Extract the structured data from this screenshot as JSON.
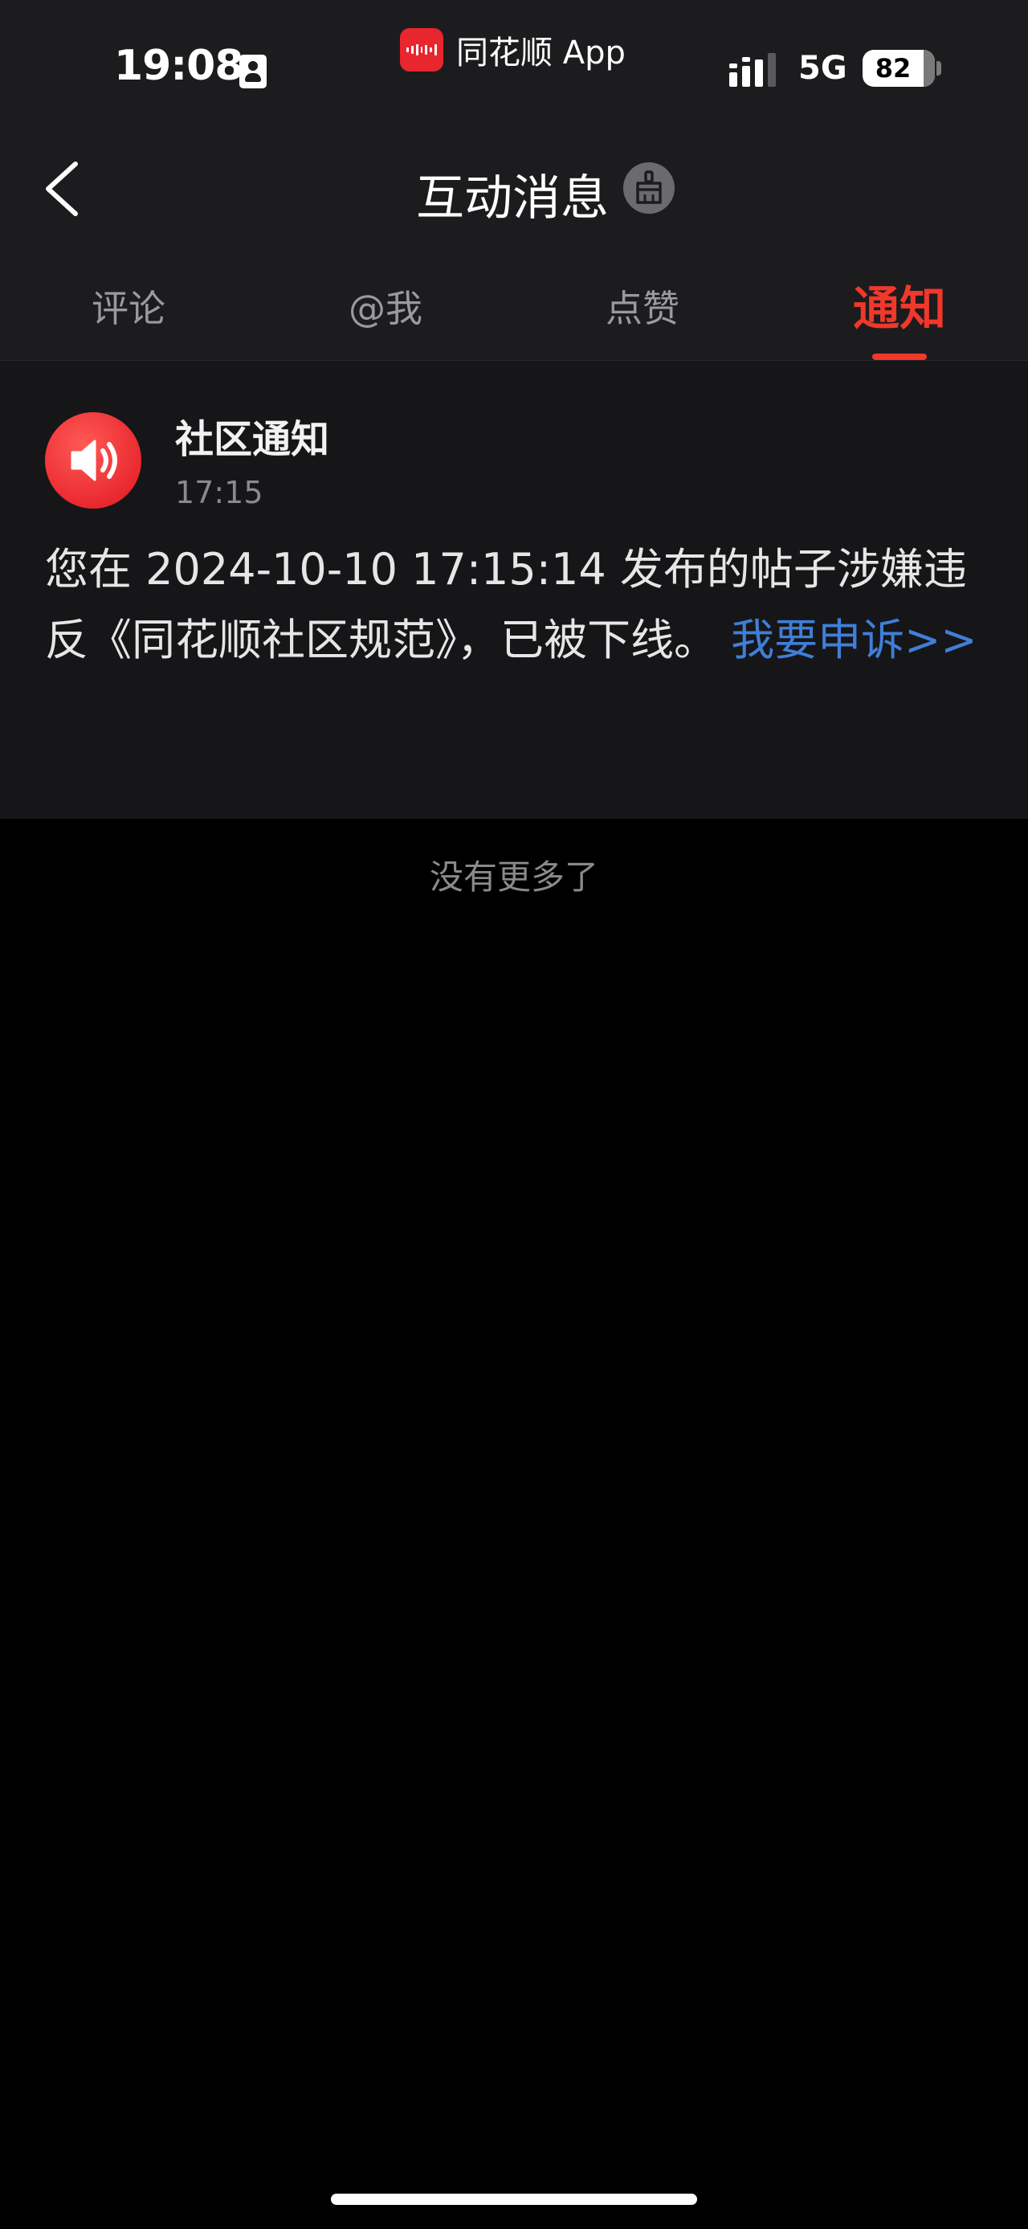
{
  "status_bar": {
    "time": "19:08",
    "app_name": "同花顺 App",
    "network": "5G",
    "battery_level": "82",
    "icons": [
      "contact-card-icon",
      "app-logo-icon",
      "signal-icon",
      "battery-icon"
    ]
  },
  "nav": {
    "title": "互动消息",
    "back_icon": "chevron-left-icon",
    "clear_icon": "broom-icon"
  },
  "tabs": [
    {
      "label": "评论",
      "active": false
    },
    {
      "label": "@我",
      "active": false
    },
    {
      "label": "点赞",
      "active": false
    },
    {
      "label": "通知",
      "active": true
    }
  ],
  "notification": {
    "icon": "speaker-icon",
    "title": "社区通知",
    "time": "17:15",
    "message": "您在 2024-10-10 17:15:14 发布的帖子涉嫌违反《同花顺社区规范》，已被下线。",
    "link_text": "我要申诉>>"
  },
  "footer": {
    "no_more": "没有更多了"
  },
  "colors": {
    "accent": "#f0382b",
    "link": "#3f7fd8",
    "header_bg": "#1c1c1e",
    "card_bg": "#161618",
    "page_bg": "#000000"
  }
}
